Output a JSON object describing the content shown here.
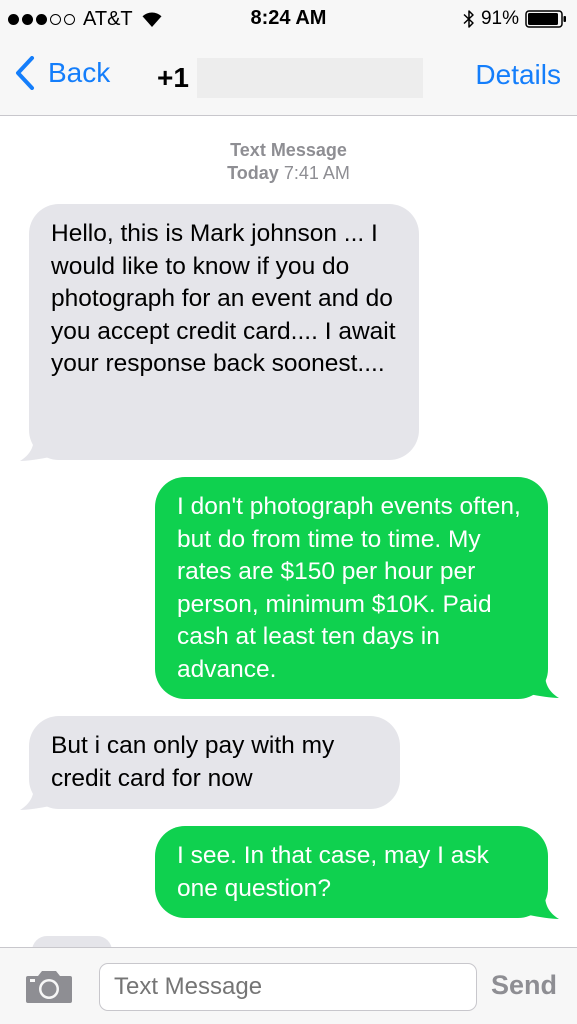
{
  "status_bar": {
    "carrier": "AT&T",
    "time": "8:24 AM",
    "battery_percent": "91%",
    "signal_strength": 3,
    "signal_max": 5
  },
  "nav": {
    "back_label": "Back",
    "contact_prefix": "+1",
    "details_label": "Details"
  },
  "conversation": {
    "timestamp_label": "Text Message",
    "timestamp_day": "Today",
    "timestamp_time": "7:41 AM",
    "messages": [
      {
        "direction": "in",
        "text": "Hello, this is Mark johnson ... I would like to know if you do photograph for an event and do you accept credit card.... I await your response back soonest...."
      },
      {
        "direction": "out",
        "text": "I don't photograph events often, but do from time to time. My rates are $150 per hour per person, minimum $10K. Paid cash at least ten days in advance."
      },
      {
        "direction": "in",
        "text": "But i can only pay with my credit card for now"
      },
      {
        "direction": "out",
        "text": "I see. In that case, may I ask one question?"
      }
    ]
  },
  "input_bar": {
    "placeholder": "Text Message",
    "send_label": "Send"
  },
  "colors": {
    "accent": "#147efb",
    "incoming_bubble": "#e5e5ea",
    "outgoing_bubble": "#0fd14f"
  }
}
